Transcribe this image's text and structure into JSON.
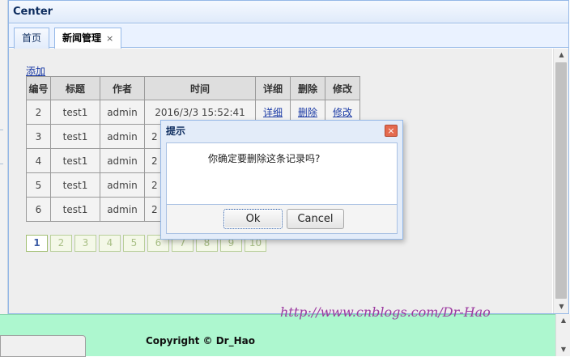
{
  "panel": {
    "title": "Center"
  },
  "tabs": [
    {
      "label": "首页",
      "active": false
    },
    {
      "label": "新闻管理",
      "active": true,
      "close_icon": "×"
    }
  ],
  "content": {
    "add_link": "添加",
    "table": {
      "headers": [
        "编号",
        "标题",
        "作者",
        "时间",
        "详细",
        "删除",
        "修改"
      ],
      "rows": [
        [
          "2",
          "test1",
          "admin",
          "2016/3/3 15:52:41",
          "详细",
          "删除",
          "修改"
        ],
        [
          "3",
          "test1",
          "admin",
          "2",
          "",
          "",
          ""
        ],
        [
          "4",
          "test1",
          "admin",
          "2",
          "",
          "",
          ""
        ],
        [
          "5",
          "test1",
          "admin",
          "2",
          "",
          "",
          ""
        ],
        [
          "6",
          "test1",
          "admin",
          "2",
          "",
          "",
          ""
        ]
      ]
    },
    "pager": {
      "pages": [
        "1",
        "2",
        "3",
        "4",
        "5",
        "6",
        "7",
        "8",
        "9",
        "10"
      ],
      "current": "1"
    }
  },
  "dialog": {
    "title": "提示",
    "message": "你确定要删除这条记录吗?",
    "close_icon": "×",
    "ok_label": "Ok",
    "cancel_label": "Cancel"
  },
  "footer": {
    "copyright": "Copyright © Dr_Hao"
  },
  "watermark": {
    "text": "http://www.cnblogs.com/Dr-Hao"
  },
  "colors": {
    "panel_border": "#95b8e7",
    "footer_bg": "#adf7cf",
    "dialog_close": "#e46a4f",
    "link": "#1a3aa5"
  }
}
